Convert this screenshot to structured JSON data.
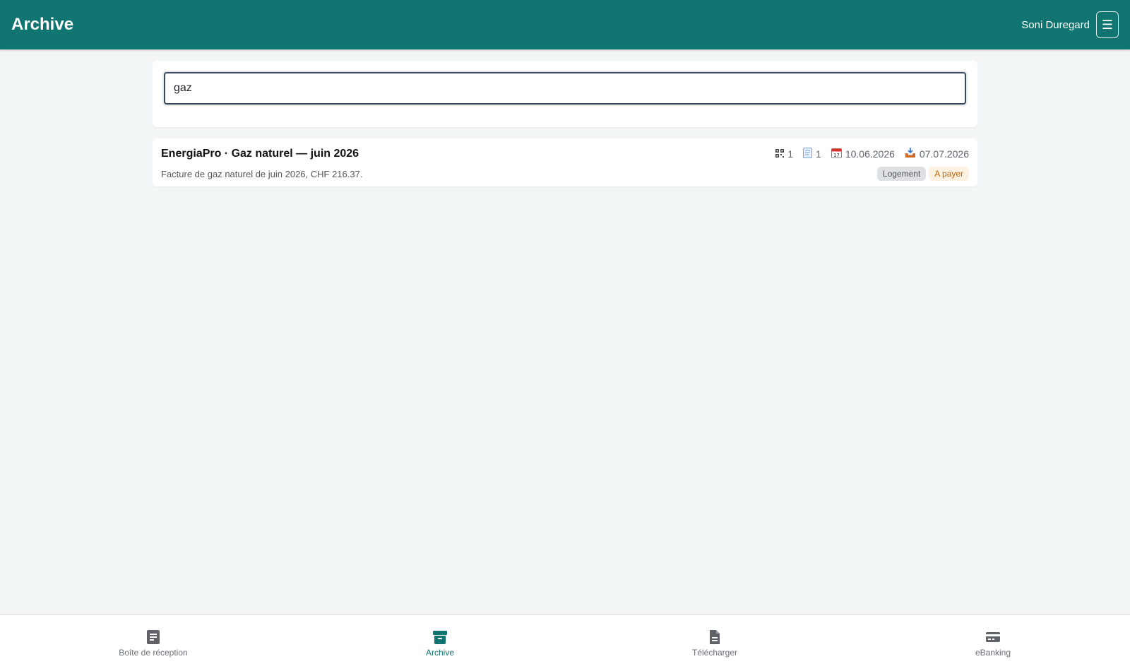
{
  "header": {
    "title": "Archive",
    "user_name": "Soni Duregard",
    "menu_icon": "☰"
  },
  "search": {
    "value": "gaz"
  },
  "results": [
    {
      "title": "EnergiaPro · Gaz naturel — juin 2026",
      "description": "Facture de gaz naturel de juin 2026, CHF 216.37.",
      "qr_count": "1",
      "doc_count": "1",
      "invoice_date": "10.06.2026",
      "received_date": "07.07.2026",
      "tags": [
        "Logement",
        "A payer"
      ]
    }
  ],
  "nav": {
    "inbox_label": "Boîte de réception",
    "archive_label": "Archive",
    "upload_label": "Télécharger",
    "ebanking_label": "eBanking"
  },
  "colors": {
    "brand": "#107570",
    "tag_grey": "#dee1e4",
    "tag_orange": "#fdf1e2"
  }
}
